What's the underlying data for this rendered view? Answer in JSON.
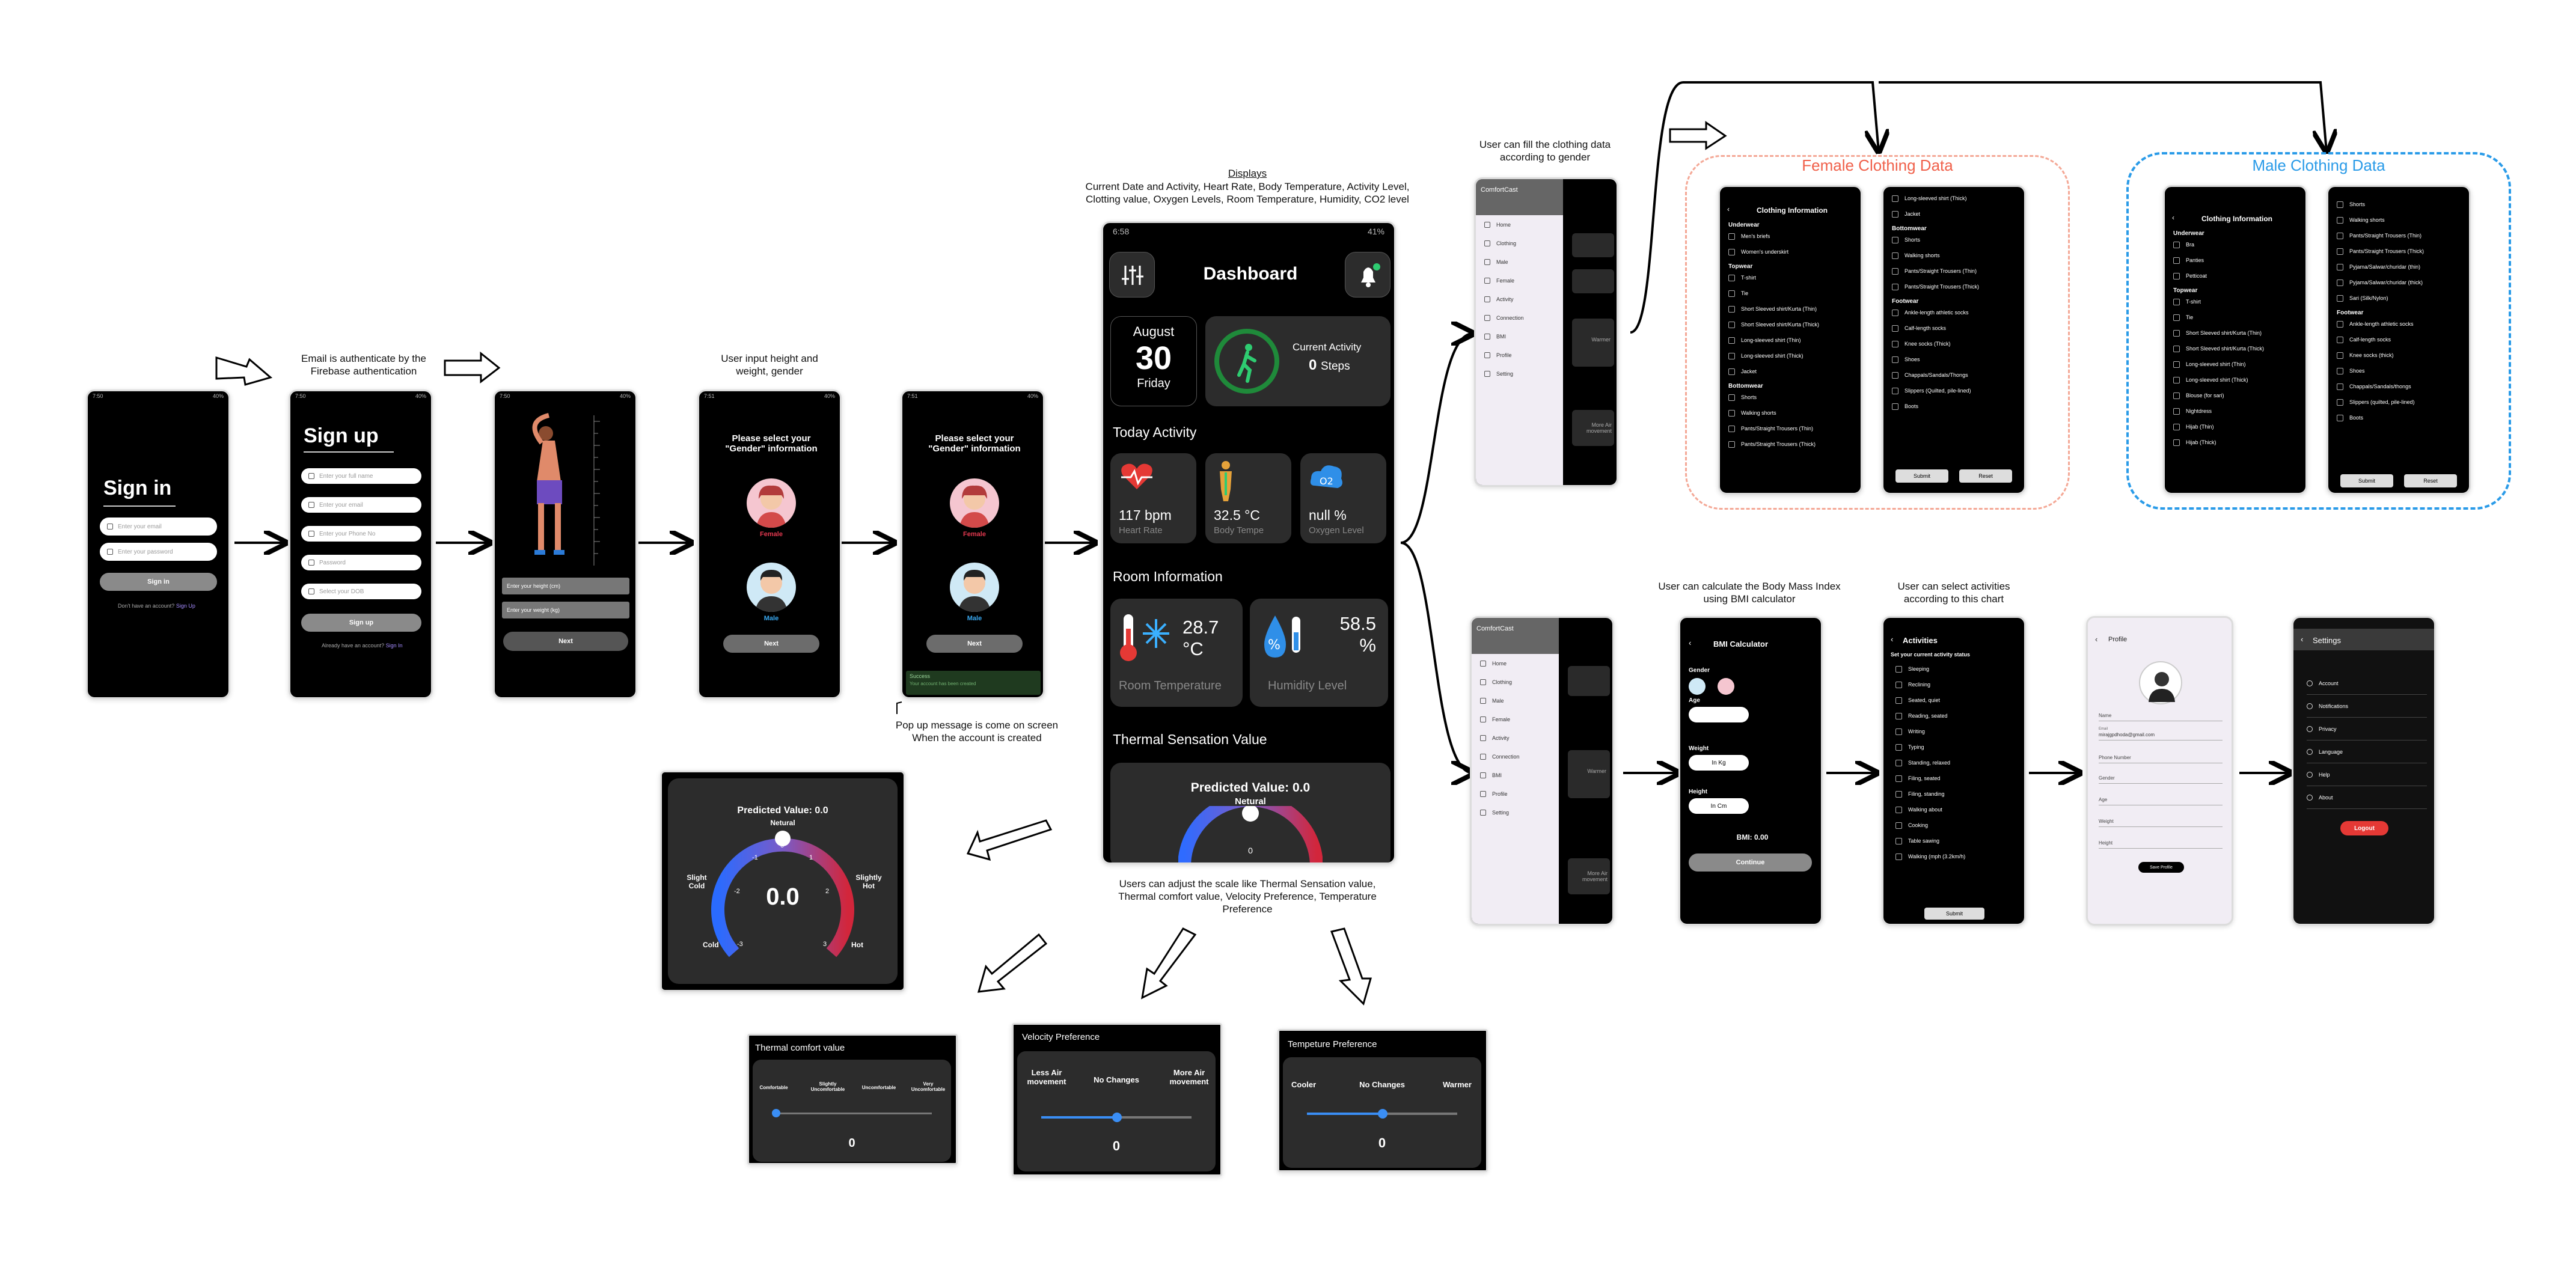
{
  "captions": {
    "email": "Email is authenticate by the Firebase authentication",
    "height": "User input height and weight, gender",
    "popup": "Pop up message is come on screen When the  account is created",
    "displays_title": "Displays",
    "displays_body": "Current Date and Activity, Heart Rate, Body Temperature, Activity Level, Clotting value, Oxygen Levels, Room Temperature, Humidity, CO2 level",
    "clothing": "User can fill the clothing data according to gender",
    "scale": "Users can adjust the scale like Thermal Sensation value, Thermal comfort value, Velocity Preference, Temperature Preference",
    "bmi": "User can calculate the Body Mass Index using BMI calculator",
    "activities": "User can select activities according to this chart"
  },
  "signin": {
    "title": "Sign in",
    "email_ph": "Enter your email",
    "pass_ph": "Enter your password",
    "button": "Sign in",
    "footer": "Don't have an account?",
    "link": "Sign Up"
  },
  "signup": {
    "title": "Sign up",
    "f1": "Enter your full name",
    "f2": "Enter your email",
    "f3": "Enter your Phone No",
    "f4": "Password",
    "f5": "Select your DOB",
    "button": "Sign up",
    "footer": "Already have an account?",
    "link": "Sign In"
  },
  "hw": {
    "h_ph": "Enter your height (cm)",
    "w_ph": "Enter your weight (kg)",
    "next": "Next"
  },
  "gender": {
    "title": "Please select your \"Gender\" information",
    "female": "Female",
    "male": "Male",
    "next": "Next",
    "toast_title": "Success",
    "toast_body": "Your account has been created"
  },
  "dash": {
    "time": "6:58",
    "battery": "41%",
    "title": "Dashboard",
    "month": "August",
    "day": "30",
    "weekday": "Friday",
    "activity_label": "Current Activity",
    "steps": "0",
    "steps_unit": "Steps",
    "today": "Today Activity",
    "hr": "117 bpm",
    "hr_lbl": "Heart Rate",
    "bt": "32.5 °C",
    "bt_lbl": "Body Tempe",
    "ox": "null %",
    "ox_lbl": "Oxygen Level",
    "room": "Room Information",
    "rt": "28.7 °C",
    "rt_lbl": "Room Temperature",
    "hu": "58.5 %",
    "hu_lbl": "Humidity Level",
    "ts": "Thermal Sensation Value",
    "pv": "Predicted Value: 0.0",
    "neutral": "Netural",
    "zero": "0"
  },
  "gauge": {
    "title": "Predicted Value: 0.0",
    "neutral": "Netural",
    "value": "0.0",
    "cold": "Cold",
    "slight_cold": "Slight Cold",
    "slight_hot": "Slightly Hot",
    "hot": "Hot",
    "t": [
      "-3",
      "-2",
      "-1",
      "0",
      "1",
      "2",
      "3"
    ]
  },
  "comfort": {
    "title": "Thermal comfort value",
    "l1": "Comfortable",
    "l2": "Slightly Uncomfortable",
    "l3": "Uncomfortable",
    "l4": "Very Uncomfortable",
    "value": "0"
  },
  "velocity": {
    "title": "Velocity Preference",
    "l1": "Less Air movement",
    "l2": "No Changes",
    "l3": "More Air movement",
    "value": "0"
  },
  "temppref": {
    "title": "Tempeture Preference",
    "l1": "Cooler",
    "l2": "No Changes",
    "l3": "Warmer",
    "value": "0"
  },
  "drawer": {
    "app": "ComfortCast",
    "items": [
      "Home",
      "Clothing",
      "Male",
      "Female",
      "Activity",
      "Connection",
      "BMI",
      "Profile",
      "Setting"
    ],
    "peek1": "Warmer",
    "peek2": "More Air movement"
  },
  "female": {
    "label": "Female Clothing  Data",
    "title": "Clothing Information",
    "under": "Underwear",
    "u": [
      "Men's briefs",
      "Women's underskirt"
    ],
    "top": "Topwear",
    "t": [
      "T-shirt",
      "Tie",
      "Short Sleeved shirt/Kurta (Thin)",
      "Short Sleeved shirt/Kurta (Thick)",
      "Long-sleeved shirt (Thin)",
      "Long-sleeved shirt (Thick)",
      "Jacket"
    ],
    "bottom": "Bottomwear",
    "b": [
      "Shorts",
      "Walking shorts",
      "Pants/Straight Trousers (Thin)",
      "Pants/Straight Trousers (Thick)"
    ],
    "p2top": [
      "Long-sleeved shirt (Thick)",
      "Jacket"
    ],
    "p2bottom": [
      "Shorts",
      "Walking shorts",
      "Pants/Straight Trousers (Thin)",
      "Pants/Straight Trousers (Thick)"
    ],
    "foot": "Footwear",
    "f": [
      "Ankle-length athletic socks",
      "Calf-length socks",
      "Knee socks (Thick)",
      "Shoes",
      "Chappals/Sandals/Thongs",
      "Slippers (Quilted, pile-lined)",
      "Boots"
    ],
    "submit": "Submit",
    "reset": "Reset"
  },
  "male": {
    "label": "Male Clothing  Data",
    "title": "Clothing Information",
    "under": "Underwear",
    "u": [
      "Bra",
      "Panties",
      "Petticoat"
    ],
    "top": "Topwear",
    "t": [
      "T-shirt",
      "Tie",
      "Short Sleeved shirt/Kurta (Thin)",
      "Short Sleeved shirt/Kurta (Thick)",
      "Long-sleeved shirt (Thin)",
      "Long-sleeved shirt (Thick)",
      "Blouse (for sari)",
      "Nightdress",
      "Hijab (Thin)",
      "Hijab (Thick)"
    ],
    "p2": [
      "Shorts",
      "Walking shorts",
      "Pants/Straight Trousers (Thin)",
      "Pants/Straight Trousers (Thick)",
      "Pyjama/Salwar/churidar (thin)",
      "Pyjama/Salwar/churidar (thick)",
      "Sari (Silk/Nylon)"
    ],
    "foot": "Footwear",
    "f": [
      "Ankle-length athletic socks",
      "Calf-length socks",
      "Knee socks (thick)",
      "Shoes",
      "Chappals/Sandals/thongs",
      "Slippers (quilted, pile-lined)",
      "Boots"
    ],
    "submit": "Submit",
    "reset": "Reset"
  },
  "bmi": {
    "title": "BMI Calculator",
    "gender": "Gender",
    "age": "Age",
    "weight": "Weight",
    "wunit": "In Kg",
    "height": "Height",
    "hunit": "In Cm",
    "result": "BMI: 0.00",
    "button": "Continue"
  },
  "act": {
    "title": "Activities",
    "sub": "Set your current activity status",
    "items": [
      "Sleeping",
      "Reclining",
      "Seated, quiet",
      "Reading, seated",
      "Writing",
      "Typing",
      "Standing, relaxed",
      "Filing, seated",
      "Filing, standing",
      "Walking about",
      "Cooking",
      "Table sawing",
      "Walking (mph (3.2km/h)"
    ],
    "submit": "Submit"
  },
  "profile": {
    "title": "Profile",
    "name": "Name",
    "email_lbl": "Email",
    "email": "mirajgpdhoda@gmail.com",
    "phone": "Phone Number",
    "gender": "Gender",
    "age": "Age",
    "weight": "Weight",
    "height": "Height",
    "button": "Save Profile"
  },
  "settings": {
    "title": "Settings",
    "items": [
      "Account",
      "Notifications",
      "Privacy",
      "Language",
      "Help",
      "About"
    ],
    "logout": "Logout"
  }
}
